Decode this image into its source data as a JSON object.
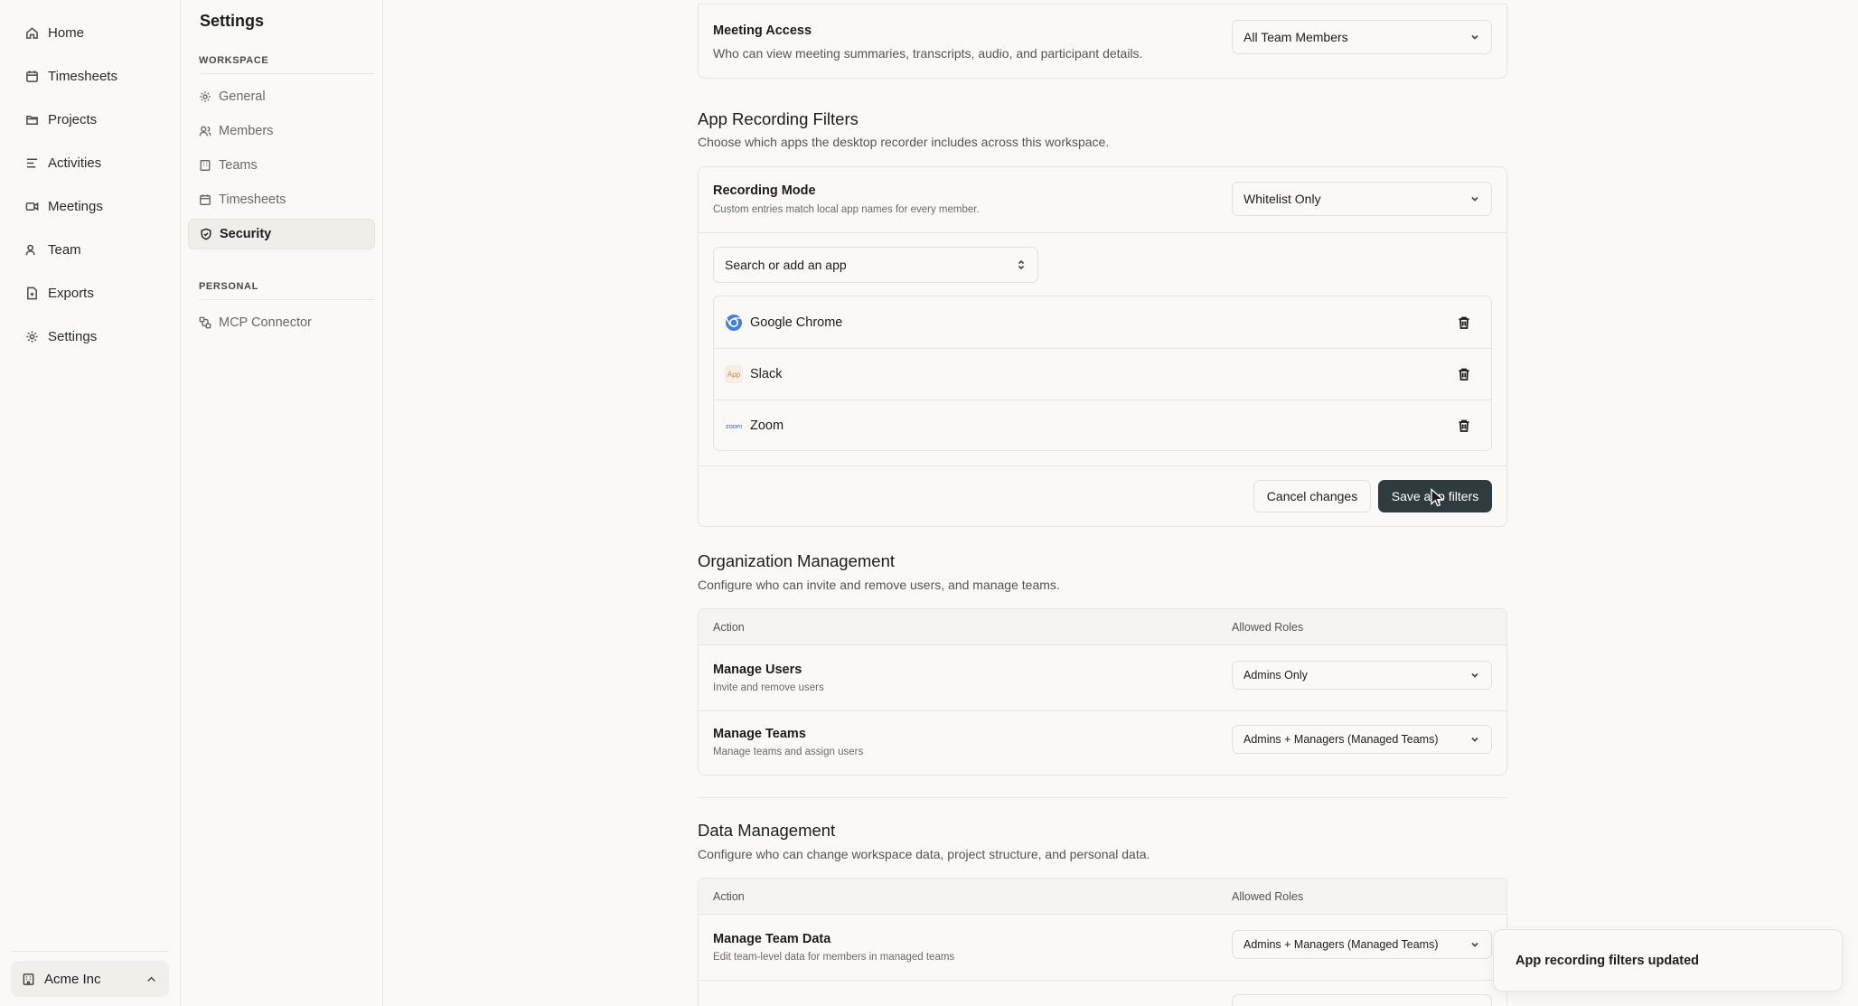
{
  "nav": {
    "items": [
      {
        "label": "Home",
        "icon": "home-icon"
      },
      {
        "label": "Timesheets",
        "icon": "calendar-icon"
      },
      {
        "label": "Projects",
        "icon": "folder-icon"
      },
      {
        "label": "Activities",
        "icon": "activity-lines-icon"
      },
      {
        "label": "Meetings",
        "icon": "video-icon"
      },
      {
        "label": "Team",
        "icon": "users-icon"
      },
      {
        "label": "Exports",
        "icon": "file-export-icon"
      },
      {
        "label": "Settings",
        "icon": "gear-icon"
      }
    ],
    "org": "Acme Inc"
  },
  "subnav": {
    "title": "Settings",
    "workspace_label": "WORKSPACE",
    "workspace_items": [
      {
        "label": "General"
      },
      {
        "label": "Members"
      },
      {
        "label": "Teams"
      },
      {
        "label": "Timesheets"
      },
      {
        "label": "Security"
      }
    ],
    "personal_label": "PERSONAL",
    "personal_items": [
      {
        "label": "MCP Connector"
      }
    ]
  },
  "meeting_access": {
    "title": "Meeting Access",
    "description": "Who can view meeting summaries, transcripts, audio, and participant details.",
    "value": "All Team Members"
  },
  "app_recording": {
    "title": "App Recording Filters",
    "description": "Choose which apps the desktop recorder includes across this workspace.",
    "mode_title": "Recording Mode",
    "mode_desc": "Custom entries match local app names for every member.",
    "mode_value": "Whitelist Only",
    "search_placeholder": "Search or add an app",
    "apps": [
      {
        "name": "Google Chrome",
        "icon": "chrome-icon"
      },
      {
        "name": "Slack",
        "icon": "app-placeholder-icon",
        "icon_text": "App"
      },
      {
        "name": "Zoom",
        "icon": "zoom-icon",
        "icon_text": "zoom"
      }
    ],
    "cancel_label": "Cancel changes",
    "save_label": "Save app filters"
  },
  "org_management": {
    "title": "Organization Management",
    "description": "Configure who can invite and remove users, and manage teams.",
    "col_action": "Action",
    "col_roles": "Allowed Roles",
    "rows": [
      {
        "title": "Manage Users",
        "desc": "Invite and remove users",
        "value": "Admins Only"
      },
      {
        "title": "Manage Teams",
        "desc": "Manage teams and assign users",
        "value": "Admins + Managers (Managed Teams)"
      }
    ]
  },
  "data_management": {
    "title": "Data Management",
    "description": "Configure who can change workspace data, project structure, and personal data.",
    "col_action": "Action",
    "col_roles": "Allowed Roles",
    "rows": [
      {
        "title": "Manage Team Data",
        "desc": "Edit team-level data for members in managed teams",
        "value": "Admins + Managers (Managed Teams)"
      }
    ]
  },
  "toast": {
    "message": "App recording filters updated"
  }
}
